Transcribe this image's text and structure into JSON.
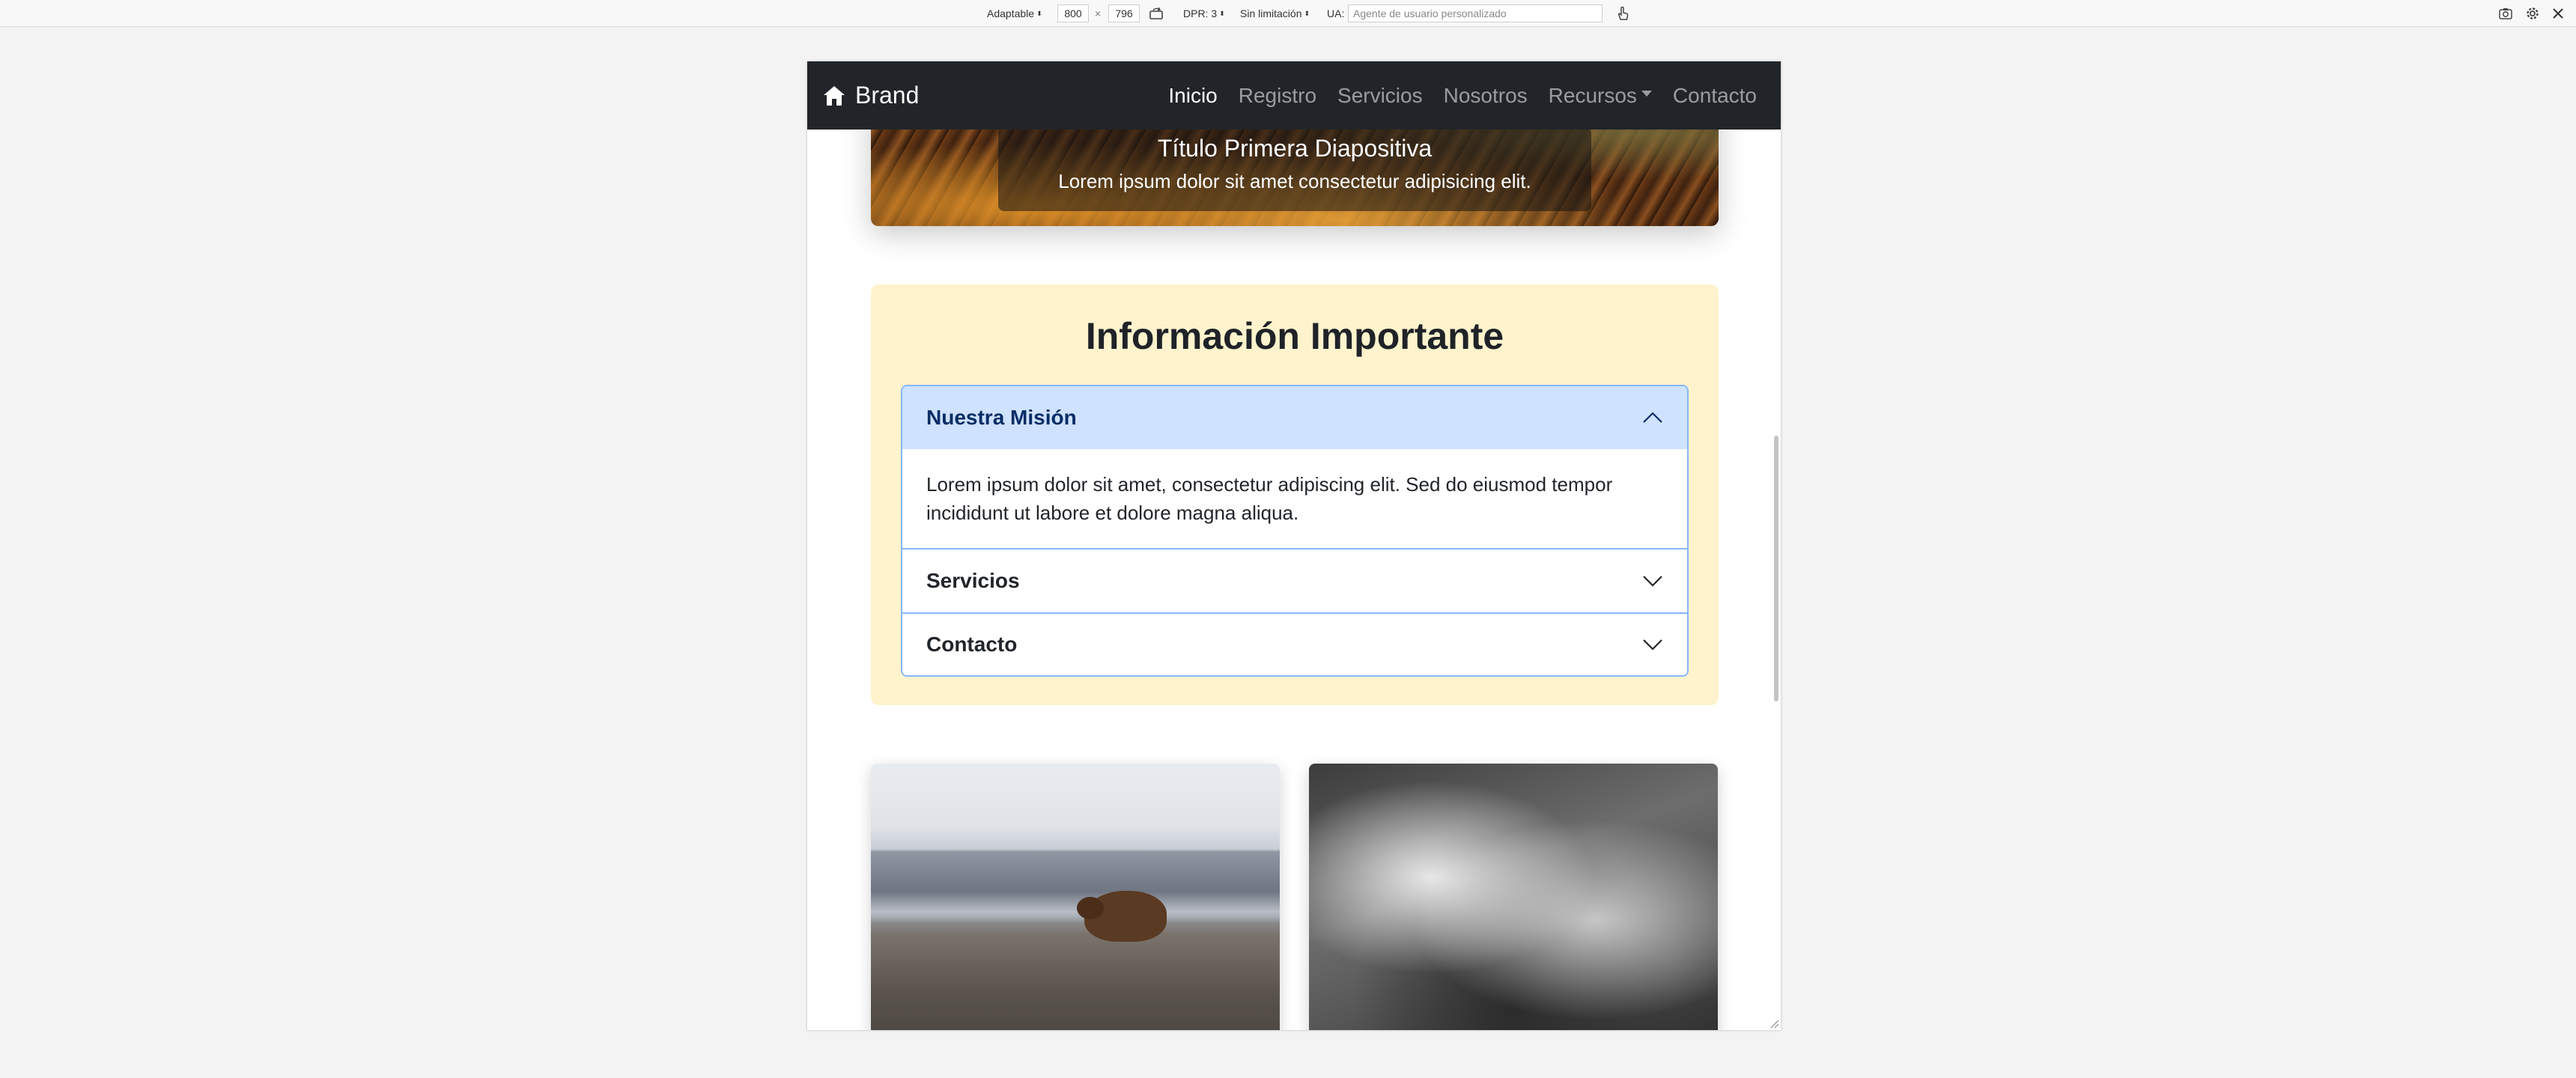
{
  "devtools": {
    "mode": "Adaptable",
    "width": "800",
    "times": "×",
    "height": "796",
    "dpr": "DPR: 3",
    "throttle": "Sin limitación",
    "ua_label": "UA:",
    "ua_placeholder": "Agente de usuario personalizado"
  },
  "navbar": {
    "brand": "Brand",
    "links": [
      {
        "label": "Inicio",
        "active": true
      },
      {
        "label": "Registro",
        "active": false
      },
      {
        "label": "Servicios",
        "active": false
      },
      {
        "label": "Nosotros",
        "active": false
      },
      {
        "label": "Recursos",
        "active": false,
        "dropdown": true
      },
      {
        "label": "Contacto",
        "active": false
      }
    ]
  },
  "carousel": {
    "title": "Título Primera Diapositiva",
    "text": "Lorem ipsum dolor sit amet consectetur adipisicing elit.",
    "slide_count": 3,
    "active_slide": 1
  },
  "info": {
    "title": "Información Importante",
    "accordion": [
      {
        "header": "Nuestra Misión",
        "open": true,
        "body": "Lorem ipsum dolor sit amet, consectetur adipiscing elit. Sed do eiusmod tempor incididunt ut labore et dolore magna aliqua."
      },
      {
        "header": "Servicios",
        "open": false
      },
      {
        "header": "Contacto",
        "open": false
      }
    ]
  },
  "colors": {
    "navbar_bg": "#212529",
    "info_bg": "#fff3cd",
    "accordion_open_bg": "#cfe2ff",
    "accordion_border": "#86b7fe"
  }
}
